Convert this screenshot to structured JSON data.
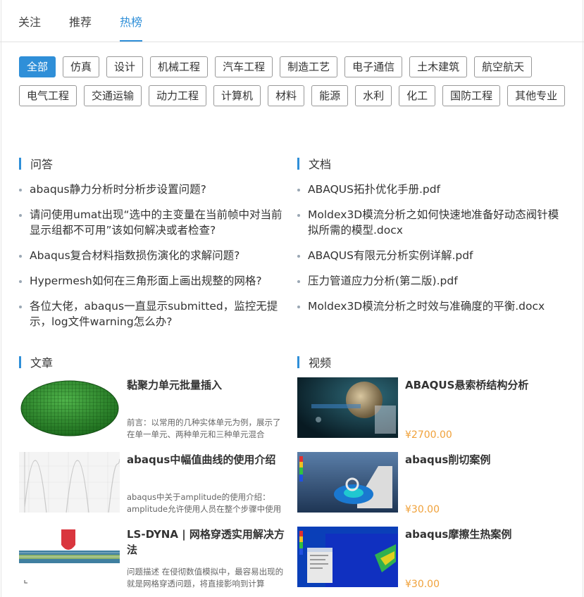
{
  "tabs": [
    {
      "label": "关注"
    },
    {
      "label": "推荐"
    },
    {
      "label": "热榜"
    }
  ],
  "tags": [
    "全部",
    "仿真",
    "设计",
    "机械工程",
    "汽车工程",
    "制造工艺",
    "电子通信",
    "土木建筑",
    "航空航天",
    "电气工程",
    "交通运输",
    "动力工程",
    "计算机",
    "材料",
    "能源",
    "水利",
    "化工",
    "国防工程",
    "其他专业"
  ],
  "qa": {
    "title": "问答",
    "items": [
      "abaqus静力分析时分析步设置问题?",
      "请问使用umat出现“选中的主变量在当前帧中对当前显示组都不可用”该如何解决或者检查?",
      "Abaqus复合材料指数损伤演化的求解问题?",
      "Hypermesh如何在三角形面上画出规整的网格?",
      "各位大佬，abaqus一直显示submitted，监控无提示，log文件warning怎么办?"
    ]
  },
  "docs": {
    "title": "文档",
    "items": [
      "ABAQUS拓扑优化手册.pdf",
      "Moldex3D模流分析之如何快速地准备好动态阀针模拟所需的模型.docx",
      "ABAQUS有限元分析实例详解.pdf",
      "压力管道应力分析(第二版).pdf",
      "Moldex3D模流分析之时效与准确度的平衡.docx"
    ]
  },
  "articles": {
    "title": "文章",
    "items": [
      {
        "title": "黏聚力单元批量插入",
        "desc": "前言：以常用的几种实体单元为例，展示了在单一单元、两种单元和三种单元混合"
      },
      {
        "title": "abaqus中幅值曲线的使用介绍",
        "desc": "abaqus中关于amplitude的使用介绍：amplitude允许使用人员在整个步骤中使用当"
      },
      {
        "title": "LS-DYNA | 网格穿透实用解决方法",
        "desc": "问题描述 在侵彻数值模拟中，最容易出现的就是网格穿透问题，将直接影响到计算"
      }
    ]
  },
  "videos": {
    "title": "视频",
    "items": [
      {
        "title": "ABAQUS悬索桥结构分析",
        "price": "¥2700.00"
      },
      {
        "title": "abaqus削切案例",
        "price": "¥30.00"
      },
      {
        "title": "abaqus摩擦生热案例",
        "price": "¥30.00"
      }
    ]
  },
  "colors": {
    "accent": "#2f8fd8",
    "price": "#f0a13a"
  }
}
